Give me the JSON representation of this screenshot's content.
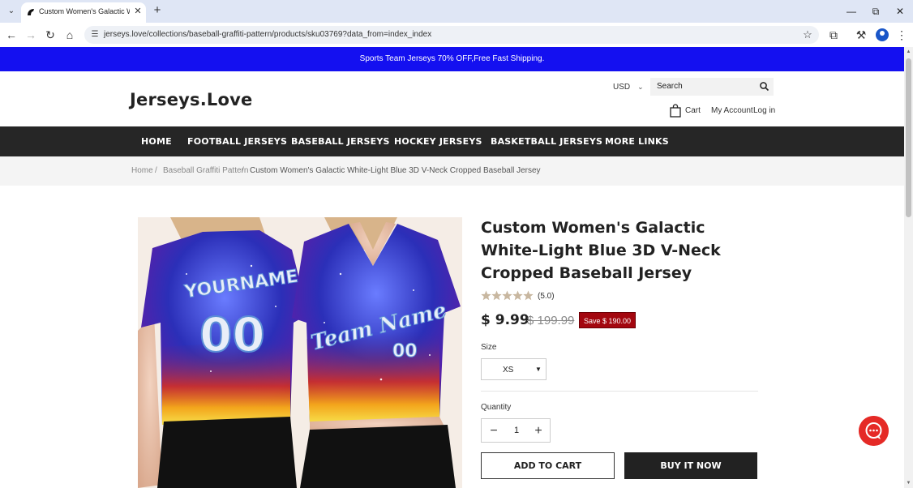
{
  "browser": {
    "tab_title": "Custom Women's Galactic White-Light Blue 3D V-Neck Cropped Baseball Jersey",
    "url": "jerseys.love/collections/baseball-graffiti-pattern/products/sku03769?data_from=index_index"
  },
  "site": {
    "announcement": "Sports Team Jerseys 70% OFF,Free Fast Shipping.",
    "logo": "Jerseys.Love",
    "currency": "USD",
    "search_placeholder": "Search",
    "cart_label": "Cart",
    "account_label": "My Account",
    "login_label": "Log in"
  },
  "nav": {
    "items": [
      "HOME",
      "FOOTBALL JERSEYS",
      "BASEBALL JERSEYS",
      "HOCKEY JERSEYS",
      "BASKETBALL JERSEYS",
      "MORE LINKS"
    ]
  },
  "breadcrumb": {
    "home": "Home",
    "separator": "/",
    "collection": "Baseball Graffiti Pattern",
    "current": "Custom Women's Galactic White-Light Blue 3D V-Neck Cropped Baseball Jersey"
  },
  "product": {
    "title": "Custom Women's Galactic White-Light Blue 3D V-Neck Cropped Baseball Jersey",
    "rating": 5,
    "rating_text": "(5.0)",
    "price": "$ 9.99",
    "compare_price": "$ 199.99",
    "save_text": "Save $ 190.00",
    "size_label": "Size",
    "size_value": "XS",
    "quantity_label": "Quantity",
    "quantity": "1",
    "add_to_cart": "ADD TO CART",
    "buy_now": "BUY IT NOW",
    "image_text": {
      "back_name": "YOURNAME",
      "back_number": "00",
      "front_team": "Team Name",
      "front_number": "00"
    }
  },
  "colors": {
    "announcement_bg": "#1410f0",
    "nav_bg": "#262626",
    "save_badge": "#a3070f",
    "chat_button": "#e52a26"
  }
}
